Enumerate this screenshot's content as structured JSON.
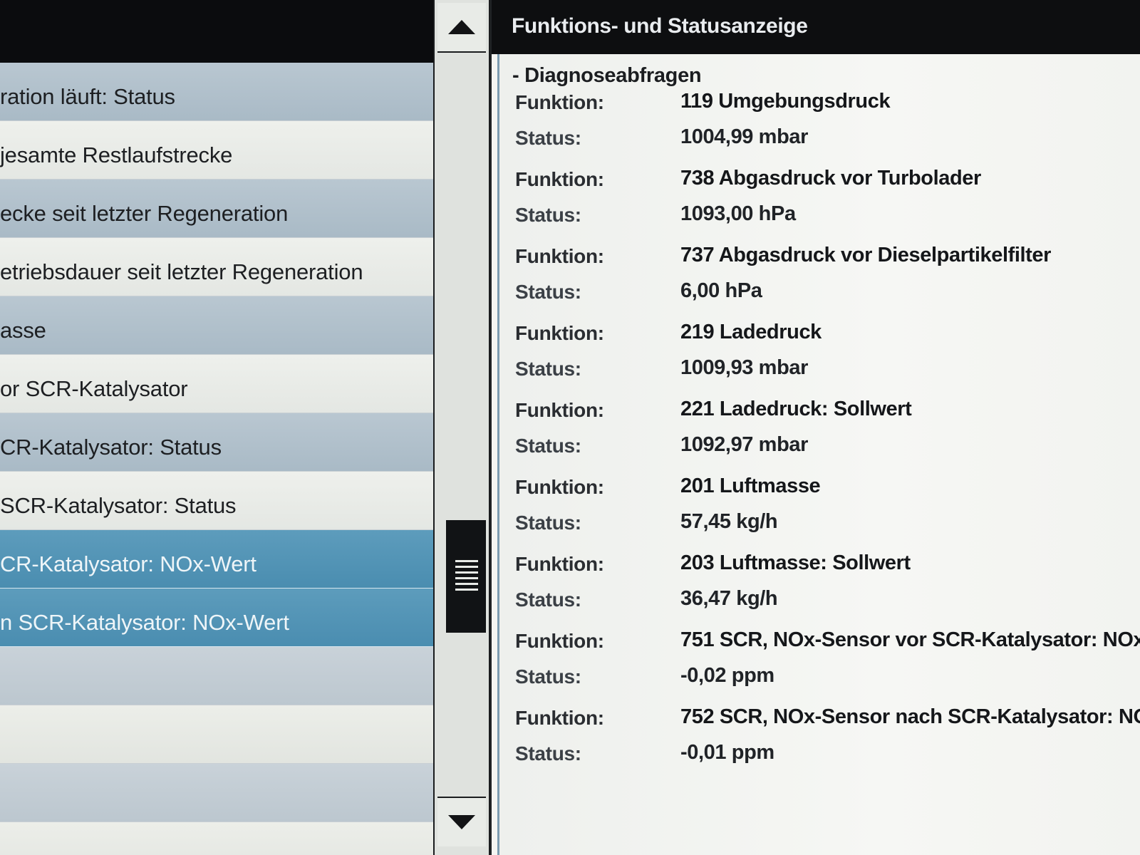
{
  "left_list": {
    "items": [
      {
        "label": "ration läuft: Status",
        "style": "alt"
      },
      {
        "label": "jesamte Restlaufstrecke",
        "style": "plain"
      },
      {
        "label": "ecke seit letzter Regeneration",
        "style": "alt"
      },
      {
        "label": "etriebsdauer seit letzter Regeneration",
        "style": "plain"
      },
      {
        "label": "asse",
        "style": "alt"
      },
      {
        "label": "or SCR-Katalysator",
        "style": "plain"
      },
      {
        "label": "CR-Katalysator: Status",
        "style": "alt"
      },
      {
        "label": "SCR-Katalysator: Status",
        "style": "plain"
      },
      {
        "label": "CR-Katalysator: NOx-Wert",
        "style": "selected"
      },
      {
        "label": "n SCR-Katalysator: NOx-Wert",
        "style": "selected"
      },
      {
        "label": "",
        "style": "empty-alt"
      },
      {
        "label": "",
        "style": "empty-plain"
      },
      {
        "label": "",
        "style": "empty-alt"
      },
      {
        "label": "",
        "style": "empty-plain"
      }
    ]
  },
  "scrollbar": {
    "up_icon": "triangle-up-icon",
    "down_icon": "triangle-down-icon",
    "thumb_icon": "grip-lines-icon"
  },
  "status_panel": {
    "title": "Funktions- und Statusanzeige",
    "section": "- Diagnoseabfragen",
    "entries": [
      {
        "function_label": "Funktion:",
        "function": "119 Umgebungsdruck",
        "status_label": "Status:",
        "status": "1004,99 mbar"
      },
      {
        "function_label": "Funktion:",
        "function": "738 Abgasdruck vor Turbolader",
        "status_label": "Status:",
        "status": "1093,00 hPa"
      },
      {
        "function_label": "Funktion:",
        "function": "737 Abgasdruck vor Dieselpartikelfilter",
        "status_label": "Status:",
        "status": "6,00 hPa"
      },
      {
        "function_label": "Funktion:",
        "function": "219 Ladedruck",
        "status_label": "Status:",
        "status": "1009,93 mbar"
      },
      {
        "function_label": "Funktion:",
        "function": "221 Ladedruck: Sollwert",
        "status_label": "Status:",
        "status": "1092,97 mbar"
      },
      {
        "function_label": "Funktion:",
        "function": "201 Luftmasse",
        "status_label": "Status:",
        "status": "57,45 kg/h"
      },
      {
        "function_label": "Funktion:",
        "function": "203 Luftmasse: Sollwert",
        "status_label": "Status:",
        "status": "36,47 kg/h"
      },
      {
        "function_label": "Funktion:",
        "function": "751 SCR, NOx-Sensor vor SCR-Katalysator: NOx-",
        "status_label": "Status:",
        "status": "-0,02 ppm"
      },
      {
        "function_label": "Funktion:",
        "function": "752 SCR, NOx-Sensor nach SCR-Katalysator: NO",
        "status_label": "Status:",
        "status": "-0,01 ppm"
      }
    ]
  }
}
